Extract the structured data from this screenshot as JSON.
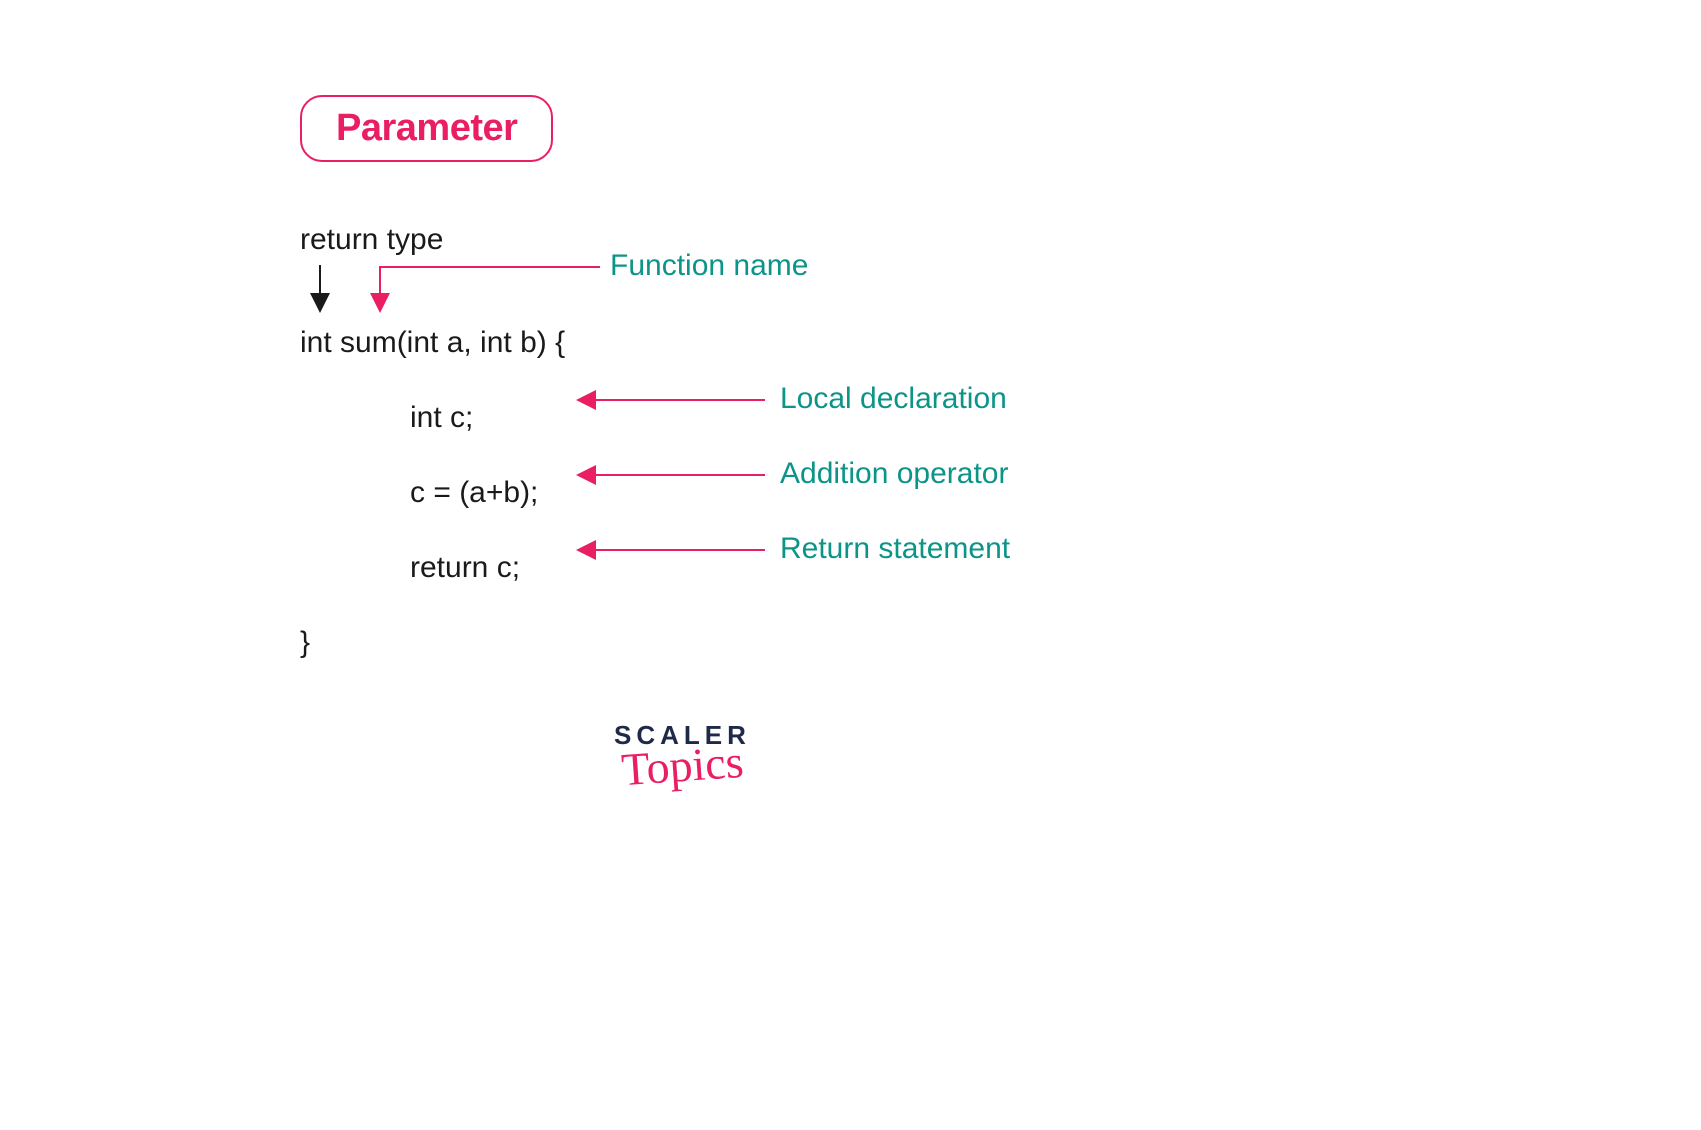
{
  "header": {
    "box_label": "Parameter"
  },
  "code": {
    "return_type_label": "return type",
    "signature": "int sum(int a, int b) {",
    "line1": "int c;",
    "line2": "c = (a+b);",
    "line3": "return c;",
    "close": "}"
  },
  "annotations": {
    "function_name": "Function name",
    "local_declaration": "Local declaration",
    "addition_operator": "Addition operator",
    "return_statement": "Return statement"
  },
  "logo": {
    "line1": "SCALER",
    "line2": "Topics"
  },
  "colors": {
    "pink": "#e91e63",
    "teal": "#0d9488",
    "dark": "#1e2a47"
  }
}
